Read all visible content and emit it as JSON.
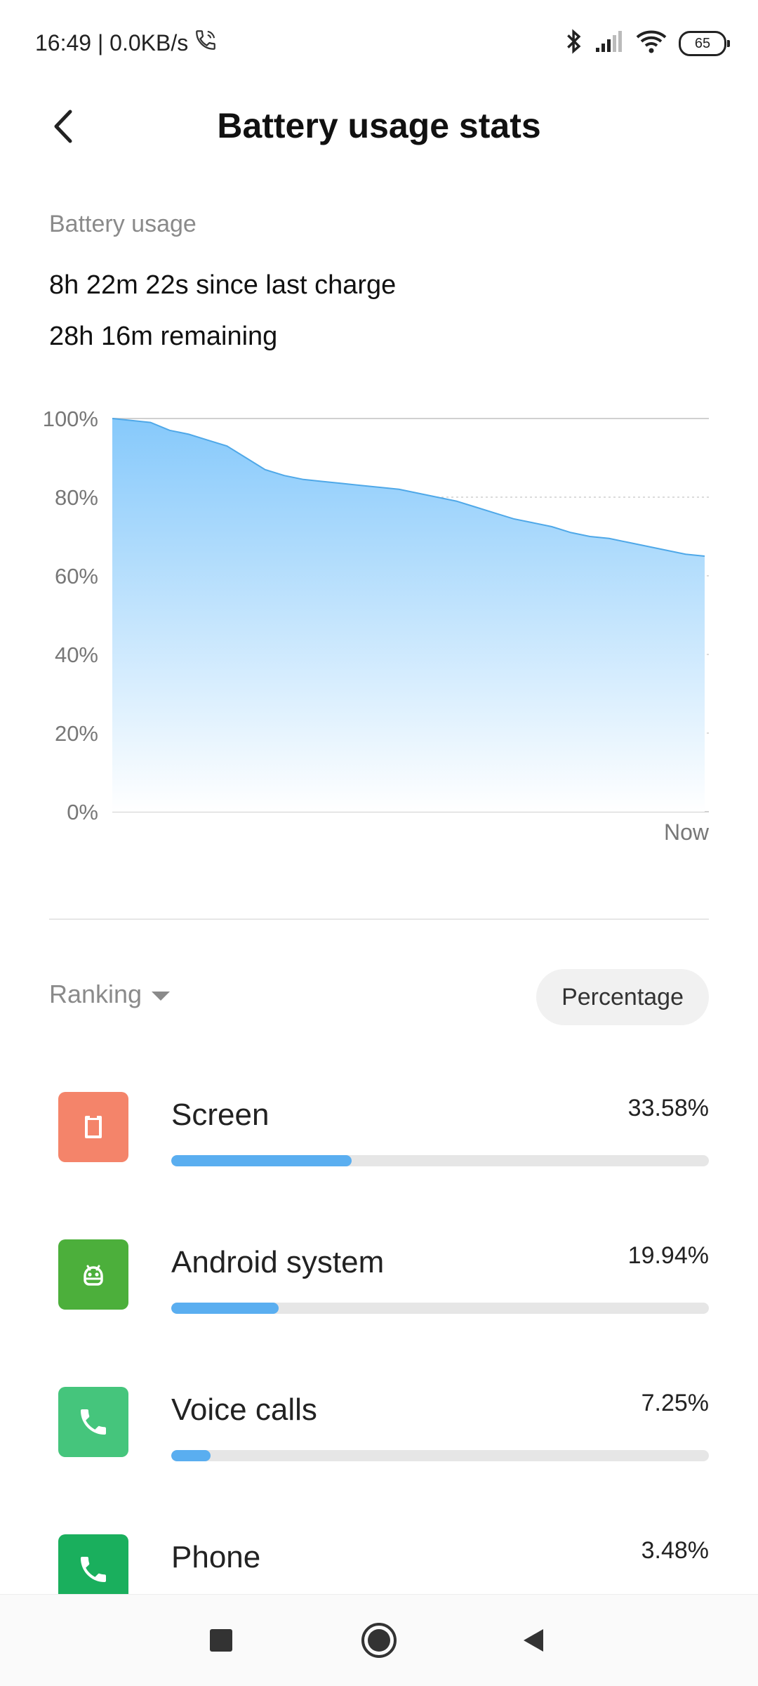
{
  "status": {
    "time_speed": "16:49 | 0.0KB/s",
    "battery_level": "65"
  },
  "header": {
    "title": "Battery usage stats"
  },
  "summary": {
    "section_label": "Battery usage",
    "since_last_charge": "8h 22m 22s since last charge",
    "remaining": "28h 16m remaining"
  },
  "chart_data": {
    "type": "area",
    "y_ticks": [
      "100%",
      "80%",
      "60%",
      "40%",
      "20%",
      "0%"
    ],
    "ylim": [
      0,
      100
    ],
    "x_end_label": "Now",
    "grid": true,
    "color": "#4fa8e8",
    "values": [
      100,
      99.5,
      99,
      97,
      96,
      94.5,
      93,
      90,
      87,
      85.5,
      84.5,
      84,
      83.5,
      83,
      82.5,
      82,
      81,
      80,
      79,
      77.5,
      76,
      74.5,
      73.5,
      72.5,
      71,
      70,
      69.5,
      68.5,
      67.5,
      66.5,
      65.5,
      65
    ]
  },
  "ranking": {
    "dropdown_label": "Ranking",
    "mode_button": "Percentage"
  },
  "usage_items": [
    {
      "name": "Screen",
      "percent": "33.58%",
      "share": 0.3358,
      "icon_color": "#f4846a",
      "icon": "screen-icon"
    },
    {
      "name": "Android system",
      "percent": "19.94%",
      "share": 0.1994,
      "icon_color": "#4caf3b",
      "icon": "android-icon"
    },
    {
      "name": "Voice calls",
      "percent": "7.25%",
      "share": 0.0725,
      "icon_color": "#45c57c",
      "icon": "phone-icon"
    },
    {
      "name": "Phone",
      "percent": "3.48%",
      "share": 0.0348,
      "icon_color": "#1aaf5d",
      "icon": "phone-icon"
    }
  ]
}
